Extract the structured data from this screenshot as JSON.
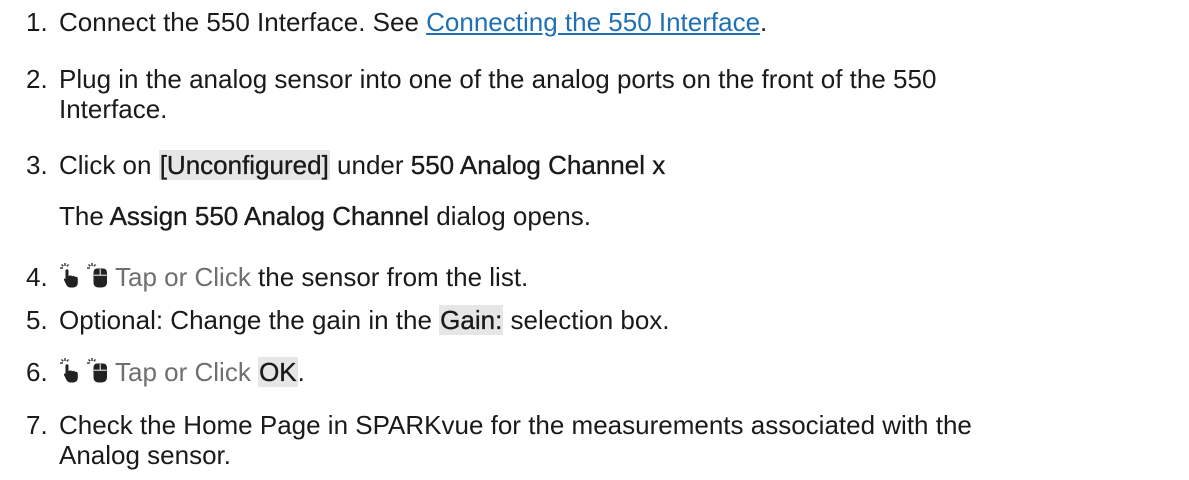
{
  "steps": [
    {
      "num": "1.",
      "text": "Connect the 550 Interface. See ",
      "link": "Connecting the 550 Interface",
      "after": "."
    },
    {
      "num": "2.",
      "line1": "Plug in the analog sensor into one of the analog ports on the front of the 550",
      "line2": "Interface."
    },
    {
      "num": "3.",
      "pre": "Click on ",
      "ui1": "[Unconfigured]",
      "mid": " under ",
      "bold1": "550 Analog Channel x",
      "sub_pre": "The ",
      "sub_bold": "Assign 550 Analog Channel",
      "sub_post": " dialog opens."
    },
    {
      "num": "4.",
      "tap": "Tap or Click",
      "post": " the sensor from the list."
    },
    {
      "num": "5.",
      "pre": "Optional: Change the gain in the ",
      "ui": "Gain:",
      "post": " selection box."
    },
    {
      "num": "6.",
      "tap": "Tap or Click",
      "ui": "OK",
      "post": "."
    },
    {
      "num": "7.",
      "line1": "Check the Home Page in SPARKvue for the measurements associated with the",
      "line2": "Analog sensor."
    }
  ],
  "icons": [
    "tap-hand-icon",
    "mouse-icon"
  ],
  "colors": {
    "text": "#1a1a1a",
    "link": "#1f6fb5",
    "tap_text": "#6f6f6f",
    "ui_highlight": "#e6e6e6"
  }
}
